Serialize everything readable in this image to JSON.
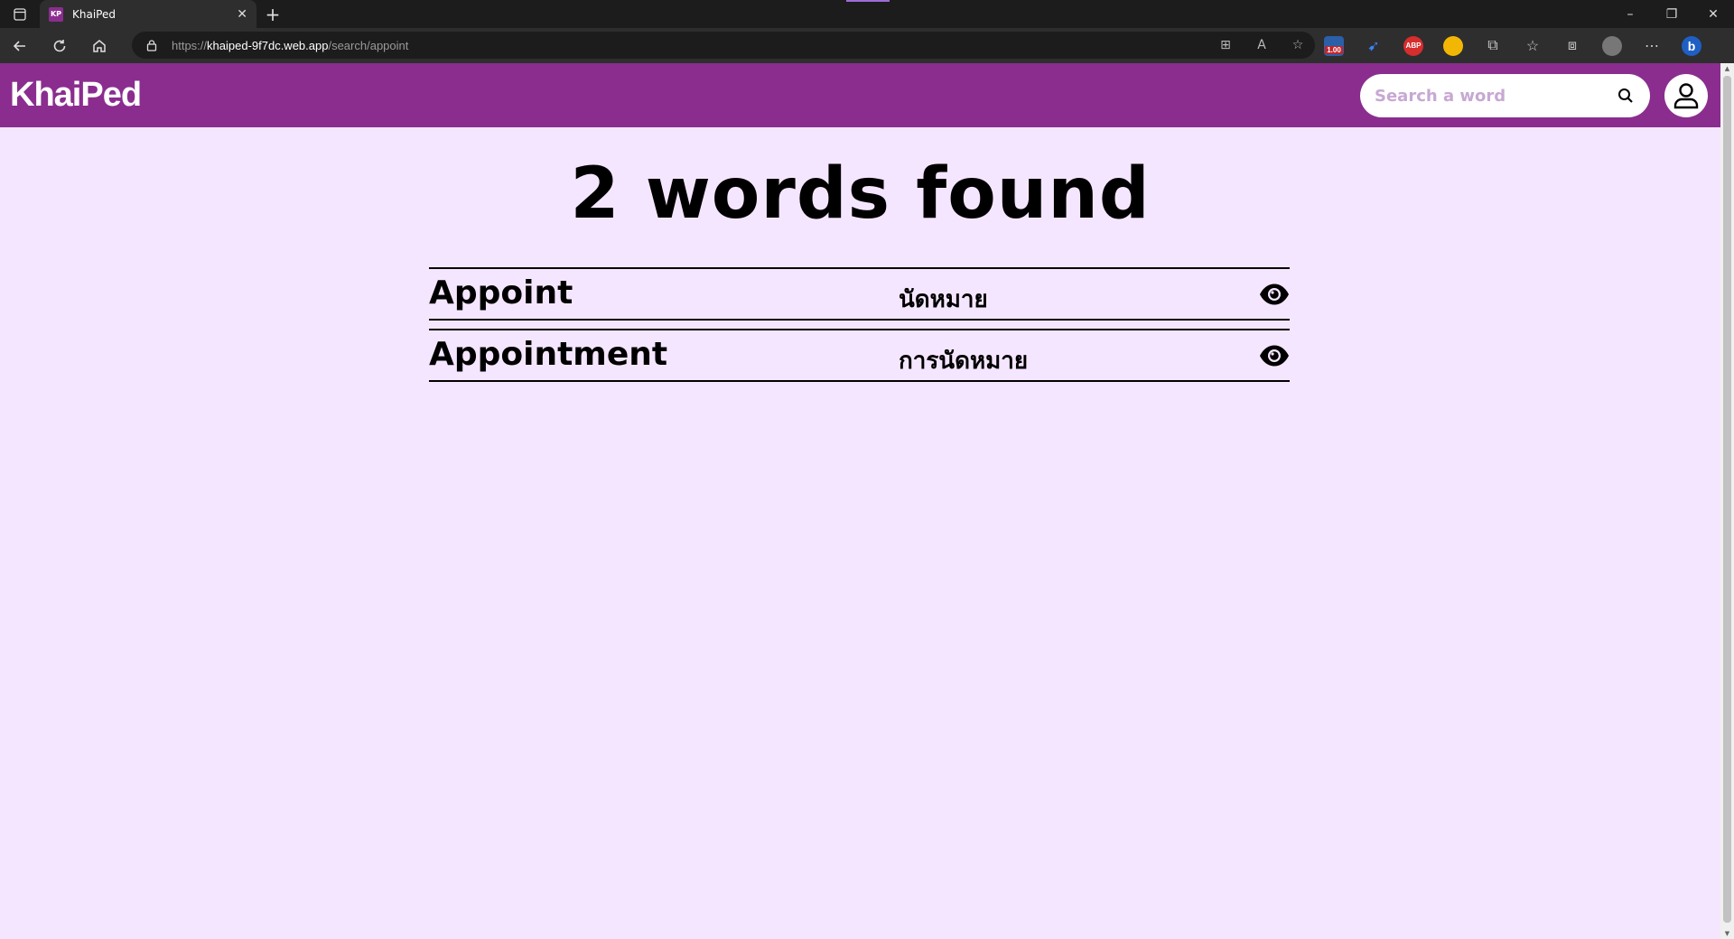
{
  "browser": {
    "tab_title": "KhaiPed",
    "favicon_text": "KP",
    "url_scheme": "https://",
    "url_host": "khaiped-9f7dc.web.app",
    "url_path": "/search/appoint",
    "extension_badge": "1.00",
    "extension_abp": "ABP"
  },
  "header": {
    "logo": "KhaiPed",
    "search_placeholder": "Search a word",
    "brand_color": "#8b2d8f"
  },
  "main": {
    "results_title": "2 words found",
    "results": [
      {
        "word": "Appoint",
        "translation": "นัดหมาย"
      },
      {
        "word": "Appointment",
        "translation": "การนัดหมาย"
      }
    ]
  },
  "icons": [
    "search-icon",
    "user-icon",
    "eye-icon"
  ]
}
